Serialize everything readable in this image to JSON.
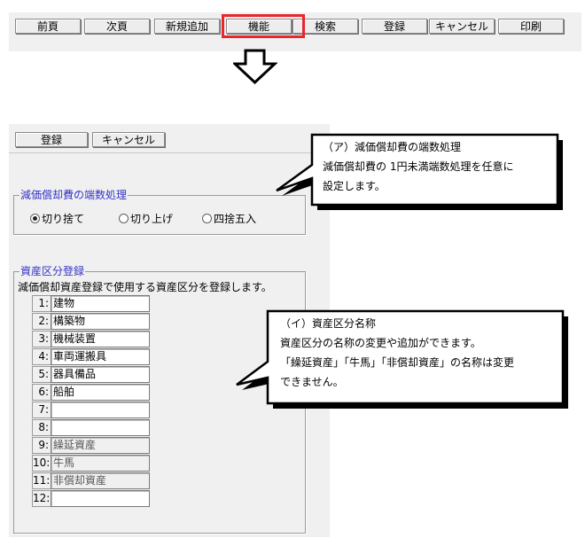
{
  "toolbar": {
    "buttons": [
      "前頁",
      "次頁",
      "新規追加",
      "機能",
      "検索",
      "登録",
      "キャンセル",
      "印刷"
    ]
  },
  "panel": {
    "buttons": {
      "register": "登録",
      "cancel": "キャンセル"
    },
    "rounding": {
      "legend": "減価償却費の端数処理",
      "options": [
        "切り捨て",
        "切り上げ",
        "四捨五入"
      ],
      "selected": "切り捨て"
    },
    "categories": {
      "legend": "資産区分登録",
      "description": "減価償却資産登録で使用する資産区分を登録します。",
      "rows": [
        {
          "num": "1:",
          "name": "建物"
        },
        {
          "num": "2:",
          "name": "構築物"
        },
        {
          "num": "3:",
          "name": "機械装置"
        },
        {
          "num": "4:",
          "name": "車両運搬具"
        },
        {
          "num": "5:",
          "name": "器具備品"
        },
        {
          "num": "6:",
          "name": "船舶"
        },
        {
          "num": "7:",
          "name": ""
        },
        {
          "num": "8:",
          "name": ""
        },
        {
          "num": "9:",
          "name": "繰延資産"
        },
        {
          "num": "10:",
          "name": "牛馬"
        },
        {
          "num": "11:",
          "name": "非償却資産"
        },
        {
          "num": "12:",
          "name": ""
        }
      ]
    }
  },
  "callouts": {
    "a": {
      "title": "（ア）減価償却費の端数処理",
      "line1": "減価償却費の 1円未満端数処理を任意に",
      "line2": "設定します。"
    },
    "b": {
      "title": "（イ）資産区分名称",
      "line1": "資産区分の名称の変更や追加ができます。",
      "line2": "「繰延資産」「牛馬」「非償却資産」の名称は変更",
      "line3": "できません。"
    }
  },
  "colors": {
    "highlight": "#e8262b",
    "legend_text": "#3232c8"
  }
}
